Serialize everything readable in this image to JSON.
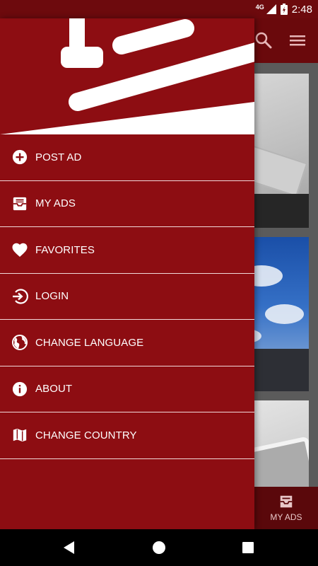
{
  "status_bar": {
    "time": "2:48",
    "network": "4G"
  },
  "toolbar": {
    "search_icon": "search-icon",
    "menu_icon": "menu-icon"
  },
  "bottom_nav": {
    "my_ads_label": "MY ADS"
  },
  "drawer": {
    "items": [
      {
        "label": "POST AD",
        "icon": "add-circle-icon"
      },
      {
        "label": "MY ADS",
        "icon": "inbox-icon"
      },
      {
        "label": "FAVORITES",
        "icon": "heart-icon"
      },
      {
        "label": "LOGIN",
        "icon": "login-icon"
      },
      {
        "label": "CHANGE LANGUAGE",
        "icon": "globe-icon"
      },
      {
        "label": "ABOUT",
        "icon": "info-icon"
      },
      {
        "label": "CHANGE COUNTRY",
        "icon": "map-icon"
      }
    ]
  },
  "colors": {
    "primary": "#8d0d12",
    "primary_dark": "#6d0a0d",
    "divider": "#f1d9da",
    "text": "#ffffff"
  }
}
